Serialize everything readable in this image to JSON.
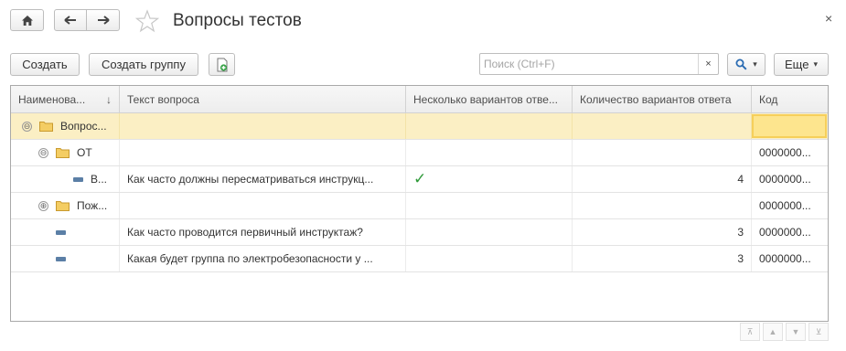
{
  "window": {
    "title": "Вопросы тестов",
    "close_glyph": "×"
  },
  "toolbar": {
    "create_label": "Создать",
    "create_group_label": "Создать группу",
    "more_label": "Еще",
    "more_arrow": "▾",
    "search_arrow": "▾"
  },
  "search": {
    "placeholder": "Поиск (Ctrl+F)",
    "value": "",
    "clear_glyph": "×"
  },
  "table": {
    "headers": {
      "name": "Наименова...",
      "name_sort": "↓",
      "question": "Текст вопроса",
      "multiple": "Несколько вариантов отве...",
      "count": "Количество вариантов ответа",
      "code": "Код"
    },
    "rows": [
      {
        "name": "Вопрос...",
        "question": "",
        "multiple": "",
        "count": "",
        "code": "",
        "kind": "folder",
        "toggle": "⊖"
      },
      {
        "name": "ОТ",
        "question": "",
        "multiple": "",
        "count": "",
        "code": "0000000...",
        "kind": "folder",
        "toggle": "⊖"
      },
      {
        "name": "В...",
        "question": "Как часто должны пересматриваться инструкц...",
        "multiple": "✓",
        "count": "4",
        "code": "0000000...",
        "kind": "leaf"
      },
      {
        "name": "Пож...",
        "question": "",
        "multiple": "",
        "count": "",
        "code": "0000000...",
        "kind": "folder",
        "toggle": "⊕"
      },
      {
        "name": "",
        "question": "Как часто проводится первичный инструктаж?",
        "multiple": "",
        "count": "3",
        "code": "0000000...",
        "kind": "leaf"
      },
      {
        "name": "",
        "question": "Какая будет группа по электробезопасности у ...",
        "multiple": "",
        "count": "3",
        "code": "0000000...",
        "kind": "leaf"
      }
    ]
  },
  "pager": {
    "first": "⊼",
    "prev": "▲",
    "next": "▼",
    "last": "⊻"
  },
  "icons": {
    "home": "home-icon",
    "back": "arrow-left-icon",
    "forward": "arrow-right-icon",
    "favorite": "star-icon",
    "add_doc": "add-document-icon",
    "search": "magnifier-icon",
    "folder": "folder-icon"
  },
  "colors": {
    "selection_row": "#fbefc4",
    "selection_cell": "#fde58e",
    "check": "#2f9a3a",
    "folder": "#f1c24a"
  }
}
